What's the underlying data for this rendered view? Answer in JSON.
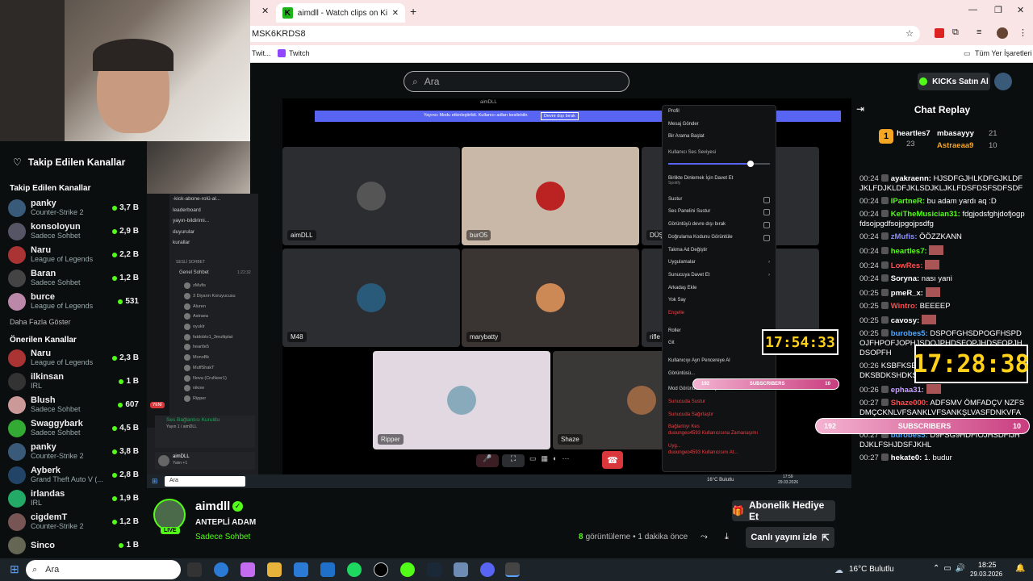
{
  "browser": {
    "tab_title": "aimdll - Watch clips on Kick",
    "url_fragment": "MSK6KRDS8",
    "bookmarks": [
      "Twit...",
      "Twitch"
    ],
    "bookmarks_right": "Tüm Yer İşaretleri"
  },
  "kick": {
    "search_placeholder": "Ara",
    "kicks_button": "KICKs Satın Al"
  },
  "sidebar": {
    "followed_header": "Takip Edilen Kanallar",
    "followed_title": "Takip Edilen Kanallar",
    "followed": [
      {
        "name": "panky",
        "game": "Counter-Strike 2",
        "count": "3,7 B",
        "color": "#3a5a7a"
      },
      {
        "name": "konsoloyun",
        "game": "Sadece Sohbet",
        "count": "2,9 B",
        "color": "#556"
      },
      {
        "name": "Naru",
        "game": "League of Legends",
        "count": "2,2 B",
        "color": "#a33"
      },
      {
        "name": "Baran",
        "game": "Sadece Sohbet",
        "count": "1,2 B",
        "color": "#444"
      },
      {
        "name": "burce",
        "game": "League of Legends",
        "count": "531",
        "color": "#b8a"
      }
    ],
    "show_more": "Daha Fazla Göster",
    "recommended_title": "Önerilen Kanallar",
    "recommended": [
      {
        "name": "Naru",
        "game": "League of Legends",
        "count": "2,3 B",
        "color": "#a33"
      },
      {
        "name": "ilkinsan",
        "game": "IRL",
        "count": "1 B",
        "color": "#333"
      },
      {
        "name": "Blush",
        "game": "Sadece Sohbet",
        "count": "607",
        "color": "#c99"
      },
      {
        "name": "Swaggybark",
        "game": "Sadece Sohbet",
        "count": "4,5 B",
        "color": "#3a3"
      },
      {
        "name": "panky",
        "game": "Counter-Strike 2",
        "count": "3,8 B",
        "color": "#3a5a7a"
      },
      {
        "name": "Ayberk",
        "game": "Grand Theft Auto V (...",
        "count": "2,8 B",
        "color": "#246"
      },
      {
        "name": "irlandas",
        "game": "IRL",
        "count": "1,9 B",
        "color": "#2a6"
      },
      {
        "name": "cigdemT",
        "game": "Counter-Strike 2",
        "count": "1,2 B",
        "color": "#755"
      },
      {
        "name": "Sinco",
        "game": "",
        "count": "1 B",
        "color": "#665"
      }
    ]
  },
  "discord_small": {
    "channels": [
      "-kick-abone-rolü-al...",
      "leaderboard",
      "yayın-bildirimi...",
      "duyurular",
      "kurallar"
    ],
    "voice_header": "SESLİ SOHBET",
    "voice_channel": "Genel Sohbet",
    "voice_time": "1:22:32",
    "members": [
      "zMufis",
      "3 Diyarın Koruyucusu",
      "Aluren",
      "Astraea",
      "oyuklr",
      "fatdoblo1_3multiplat",
      "heartle5",
      "MonoBk",
      "MuffShakT",
      "Nova (CruNeer1)",
      "nikow",
      "Ripper"
    ],
    "connection": "Ses Bağlantısı Kuruldu",
    "connection_sub": "Yayın 1 / aimDLL",
    "user": "aimDLL",
    "user_status": "Yalın +1",
    "badge_new": "YENİ"
  },
  "call": {
    "window_title": "aimDLL",
    "banner": "Yayıncı Modu etkinleştirildi. Kullanıcı adları kesilebilir.",
    "banner_button": "Devre dışı bırak",
    "tiles": [
      {
        "label": "aimDLL",
        "bg": "#2b2d31",
        "av": "#555"
      },
      {
        "label": "burO5",
        "bg": "#c9b8a8",
        "av": "#b22"
      },
      {
        "label": "DÜŞ",
        "bg": "#2b2d31",
        "av": "#444"
      },
      {
        "label": "M48",
        "bg": "#2b2d31",
        "av": "#2a5a7a"
      },
      {
        "label": "marybatty",
        "bg": "#3a3432",
        "av": "#c85"
      },
      {
        "label": "rifle",
        "bg": "#2b2d31",
        "av": "#444"
      },
      {
        "label": "Ripper",
        "bg": "#e2d8e2",
        "av": "#8ab"
      },
      {
        "label": "Shaze",
        "bg": "#3a3836",
        "av": "#964"
      }
    ]
  },
  "context_menu": {
    "items": [
      "Profil",
      "Mesaj Gönder",
      "Bir Arama Başlat"
    ],
    "volume_label": "Kullanıcı Ses Seviyesi",
    "volume_level": 0.8,
    "listen_title": "Birlikte Dinlemek İçin Davet Et",
    "listen_sub": "Spotify",
    "items2": [
      "Sustur",
      "Ses Panelini Sustur",
      "Görüntüyü devre dışı bırak",
      "Doğrulama Kodunu Görüntüle",
      "Takma Ad Değiştir",
      "Uygulamalar",
      "Sunucuya Davet Et",
      "Arkadaş Ekle",
      "Yok Say",
      "Engelle"
    ],
    "items3": [
      "Roller",
      "Git"
    ],
    "items4": [
      "Kullanıcıyı Ayrı Pencereye Al",
      "Görüntüsü..."
    ],
    "mod_title": "Mod Görünümünde Aç",
    "mod_items": [
      "Sunucuda Sustur",
      "Sunucuda Sağırlaştır",
      "Bağlantıyı Kes",
      "duoungeo4593 Kullanıcısına Zamanaşımı Uyg...",
      "duoungeo4593 Kullanıcısını At..."
    ]
  },
  "overlays": {
    "timer_small": "17:54:33",
    "timer_large": "17:28:38",
    "subs_label": "SUBSCRIBERS",
    "subs_left": "192",
    "subs_right": "10"
  },
  "chat": {
    "title": "Chat Replay",
    "leaderboard": [
      {
        "rank": "1",
        "name": "heartles7",
        "value": "23"
      },
      {
        "name": "mbasayyy",
        "value": "21"
      },
      {
        "name": "Astraeaa9",
        "value": "10"
      }
    ],
    "messages": [
      {
        "t": "00:24",
        "u": "ayakraenn:",
        "c": "#fff",
        "m": "HJSDFGJHLKDFGJKLDFJKLFDJKLDFJKLSDJKLJKLFDSFDSFSDFSDF"
      },
      {
        "t": "00:24",
        "u": "IPartneR:",
        "c": "#53fc18",
        "m": "bu adam yardı aq :D"
      },
      {
        "t": "00:24",
        "u": "KeiTheMusician31:",
        "c": "#53fc18",
        "m": "fdgjodsfghjdofjogpfdsojpgdfsojpgojpsdfg"
      },
      {
        "t": "00:24",
        "u": "zMufis:",
        "c": "#8a8cff",
        "m": "ÖÖZZKANN"
      },
      {
        "t": "00:24",
        "u": "heartles7:",
        "c": "#53fc18",
        "m": ""
      },
      {
        "t": "00:24",
        "u": "LowRes:",
        "c": "#ff4d4d",
        "m": ""
      },
      {
        "t": "00:24",
        "u": "Soryna:",
        "c": "#fff",
        "m": "nası yani"
      },
      {
        "t": "00:25",
        "u": "pmeR_x:",
        "c": "#fff",
        "m": ""
      },
      {
        "t": "00:25",
        "u": "Wintro:",
        "c": "#ff4d4d",
        "m": "BEEEEP"
      },
      {
        "t": "00:25",
        "u": "cavosy:",
        "c": "#fff",
        "m": ""
      },
      {
        "t": "00:25",
        "u": "burobes5:",
        "c": "#53a8ff",
        "m": "DSPOFGHSDPOGFHSPDOJFHPOFJOPHJSDOJPHDSFOPJHDSFOPJHDSOPFH"
      },
      {
        "t": "00:26",
        "u": "",
        "c": "#fff",
        "m": "KSBFKSBFKSHFKSHFKSHDKSBDKSHDKSBDKSHDKSBD"
      },
      {
        "t": "00:26",
        "u": "ephaa31:",
        "c": "#c9a0ff",
        "m": ""
      },
      {
        "t": "00:27",
        "u": "Shaze000:",
        "c": "#ff4d4d",
        "m": "ADFSMV ÖMFADÇV NZFSDMÇCKNLVFSANKLVFSANKŞLVASFDNKVFAKNSVKNAFVKNAVNKFKAVFDS"
      },
      {
        "t": "00:27",
        "u": "burobes5:",
        "c": "#53a8ff",
        "m": "D9FSG9HDFIOJHSDFIJHDJKLFSHJDSFJKHL"
      },
      {
        "t": "00:27",
        "u": "hekate0:",
        "c": "#fff",
        "m": "1. budur"
      }
    ]
  },
  "channel": {
    "name": "aimdll",
    "title": "ANTEPLİ ADAM",
    "category": "Sadece Sohbet",
    "live_badge": "LIVE",
    "views": "8",
    "views_label": "görüntüleme",
    "ago": "• 1 dakika önce",
    "gift_button": "Abonelik Hediye Et",
    "watch_live": "Canlı yayını izle"
  },
  "inner_taskbar": {
    "search": "Ara",
    "weather": "16°C Bulutlu",
    "time": "17:59",
    "date": "29.03.2026"
  },
  "taskbar": {
    "search": "Ara",
    "weather": "16°C Bulutlu",
    "time": "18:25",
    "date": "29.03.2026"
  }
}
